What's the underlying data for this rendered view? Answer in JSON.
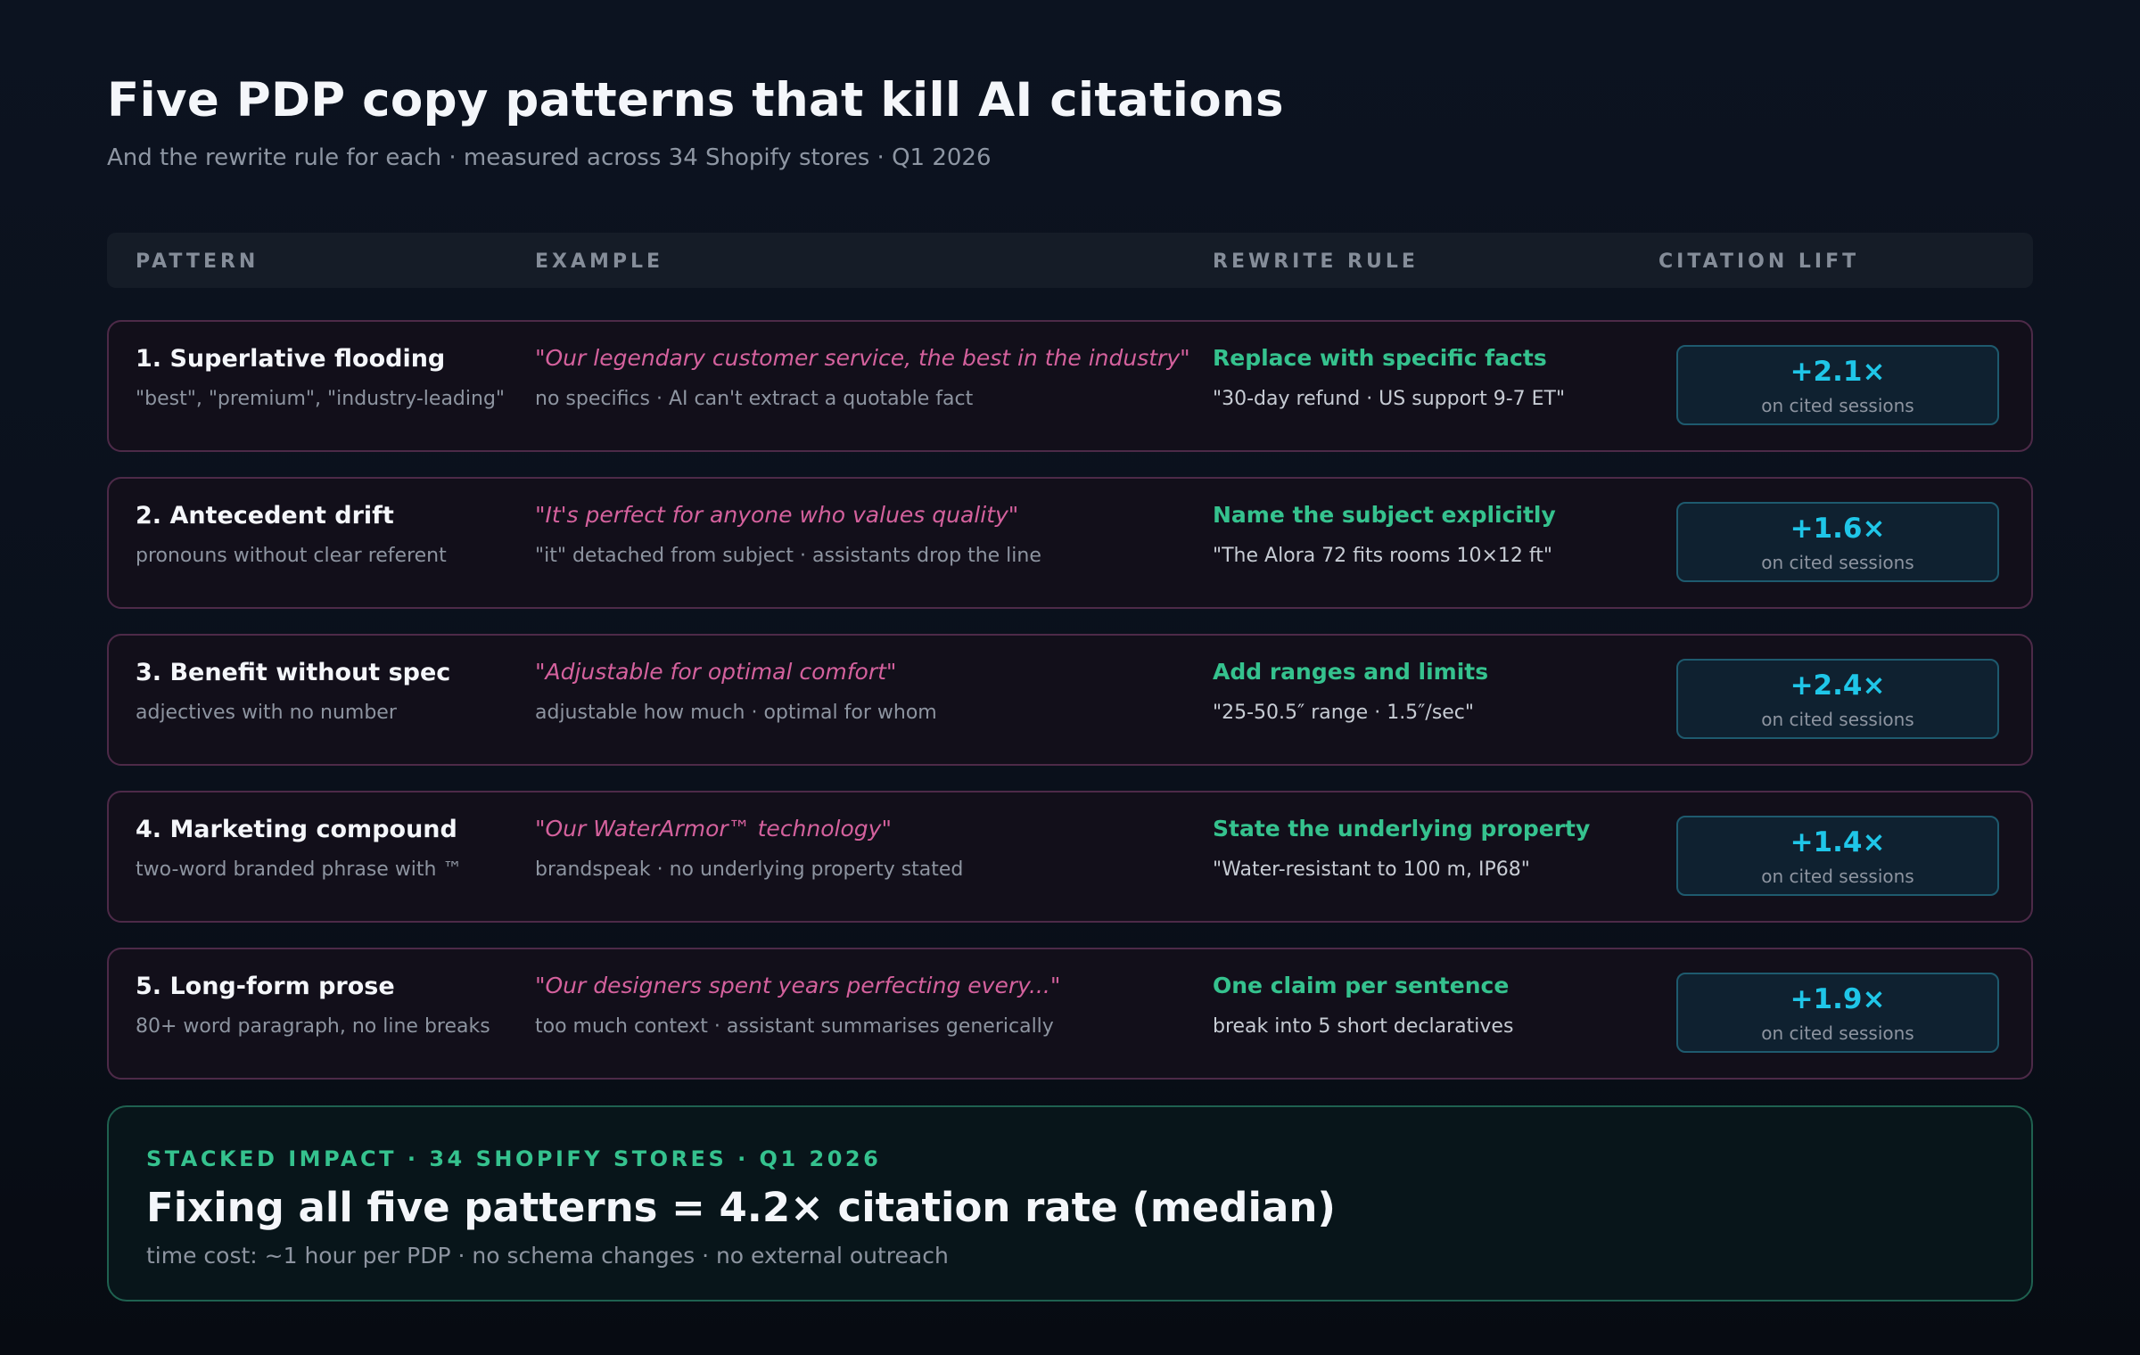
{
  "header": {
    "title": "Five PDP copy patterns that kill AI citations",
    "subtitle": "And the rewrite rule for each · measured across 34 Shopify stores · Q1 2026"
  },
  "columns": {
    "pattern": "PATTERN",
    "example": "EXAMPLE",
    "rewrite": "REWRITE RULE",
    "lift": "CITATION LIFT"
  },
  "rows": [
    {
      "title": "1. Superlative flooding",
      "desc": "\"best\", \"premium\", \"industry-leading\"",
      "quote": "\"Our legendary customer service, the best in the industry\"",
      "note": "no specifics · AI can't extract a quotable fact",
      "rule": "Replace with specific facts",
      "rule_example": "\"30-day refund · US support 9-7 ET\"",
      "lift": "+2.1×",
      "lift_label": "on cited sessions"
    },
    {
      "title": "2. Antecedent drift",
      "desc": "pronouns without clear referent",
      "quote": "\"It's perfect for anyone who values quality\"",
      "note": "\"it\" detached from subject · assistants drop the line",
      "rule": "Name the subject explicitly",
      "rule_example": "\"The Alora 72 fits rooms 10×12 ft\"",
      "lift": "+1.6×",
      "lift_label": "on cited sessions"
    },
    {
      "title": "3. Benefit without spec",
      "desc": "adjectives with no number",
      "quote": "\"Adjustable for optimal comfort\"",
      "note": "adjustable how much · optimal for whom",
      "rule": "Add ranges and limits",
      "rule_example": "\"25-50.5″ range · 1.5″/sec\"",
      "lift": "+2.4×",
      "lift_label": "on cited sessions"
    },
    {
      "title": "4. Marketing compound",
      "desc": "two-word branded phrase with ™",
      "quote": "\"Our WaterArmor™ technology\"",
      "note": "brandspeak · no underlying property stated",
      "rule": "State the underlying property",
      "rule_example": "\"Water-resistant to 100 m, IP68\"",
      "lift": "+1.4×",
      "lift_label": "on cited sessions"
    },
    {
      "title": "5. Long-form prose",
      "desc": "80+ word paragraph, no line breaks",
      "quote": "\"Our designers spent years perfecting every...\"",
      "note": "too much context · assistant summarises generically",
      "rule": "One claim per sentence",
      "rule_example": "break into 5 short declaratives",
      "lift": "+1.9×",
      "lift_label": "on cited sessions"
    }
  ],
  "impact": {
    "kicker": "STACKED IMPACT · 34 SHOPIFY STORES · Q1 2026",
    "headline": "Fixing all five patterns = 4.2× citation rate (median)",
    "note": "time cost: ~1 hour per PDP · no schema changes · no external outreach"
  },
  "colors": {
    "pattern_border": "#4d2a48",
    "quote": "#d4619d",
    "rule": "#35c28e",
    "lift": "#1fc6e8"
  }
}
